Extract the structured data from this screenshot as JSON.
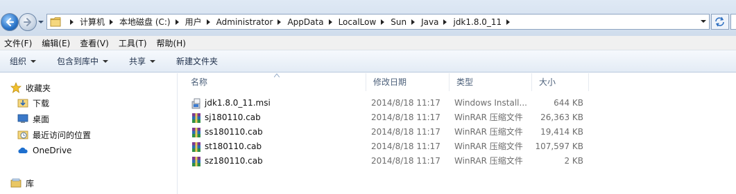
{
  "address": {
    "crumbs": [
      "计算机",
      "本地磁盘 (C:)",
      "用户",
      "Administrator",
      "AppData",
      "LocalLow",
      "Sun",
      "Java",
      "jdk1.8.0_11"
    ]
  },
  "menu": [
    "文件(F)",
    "编辑(E)",
    "查看(V)",
    "工具(T)",
    "帮助(H)"
  ],
  "toolbar": {
    "organize": "组织",
    "include_in_library": "包含到库中",
    "share": "共享",
    "new_folder": "新建文件夹"
  },
  "nav": {
    "favorites": "收藏夹",
    "downloads": "下载",
    "desktop": "桌面",
    "recent": "最近访问的位置",
    "onedrive": "OneDrive",
    "libraries": "库"
  },
  "columns": {
    "name": "名称",
    "date": "修改日期",
    "type": "类型",
    "size": "大小"
  },
  "files": [
    {
      "name": "jdk1.8.0_11.msi",
      "date": "2014/8/18 11:17",
      "type": "Windows Install...",
      "size": "644 KB",
      "icon": "msi-installer-icon"
    },
    {
      "name": "sj180110.cab",
      "date": "2014/8/18 11:17",
      "type": "WinRAR 压缩文件",
      "size": "26,363 KB",
      "icon": "winrar-archive-icon"
    },
    {
      "name": "ss180110.cab",
      "date": "2014/8/18 11:17",
      "type": "WinRAR 压缩文件",
      "size": "19,414 KB",
      "icon": "winrar-archive-icon"
    },
    {
      "name": "st180110.cab",
      "date": "2014/8/18 11:17",
      "type": "WinRAR 压缩文件",
      "size": "107,597 KB",
      "icon": "winrar-archive-icon"
    },
    {
      "name": "sz180110.cab",
      "date": "2014/8/18 11:17",
      "type": "WinRAR 压缩文件",
      "size": "2 KB",
      "icon": "winrar-archive-icon"
    }
  ]
}
